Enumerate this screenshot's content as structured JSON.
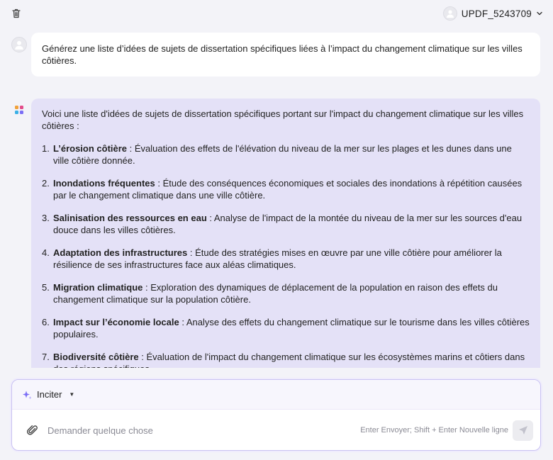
{
  "header": {
    "username": "UPDF_5243709"
  },
  "conversation": {
    "user_message": "Générez une liste d’idées de sujets de dissertation spécifiques liées à l’impact du changement climatique sur les villes côtières.",
    "ai_intro": "Voici une liste d'idées de sujets de dissertation spécifiques portant sur l'impact du changement climatique sur les villes côtières :",
    "ai_items": [
      {
        "num": "1.",
        "title": "L’érosion côtière",
        "text": " : Évaluation des effets de l'élévation du niveau de la mer sur les plages et les dunes dans une ville côtière donnée."
      },
      {
        "num": "2.",
        "title": "Inondations fréquentes",
        "text": " : Étude des conséquences économiques et sociales des inondations à répétition causées par le changement climatique dans une ville côtière."
      },
      {
        "num": "3.",
        "title": "Salinisation des ressources en eau",
        "text": " : Analyse de l'impact de la montée du niveau de la mer sur les sources d'eau douce dans les villes côtières."
      },
      {
        "num": "4.",
        "title": "Adaptation des infrastructures",
        "text": " : Étude des stratégies mises en œuvre par une ville côtière pour améliorer la résilience de ses infrastructures face aux aléas climatiques."
      },
      {
        "num": "5.",
        "title": "Migration climatique",
        "text": " : Exploration des dynamiques de déplacement de la population en raison des effets du changement climatique sur la population côtière."
      },
      {
        "num": "6.",
        "title": "Impact sur l’économie locale",
        "text": " : Analyse des effets du changement climatique sur le tourisme dans les villes côtières populaires."
      },
      {
        "num": "7.",
        "title": "Biodiversité côtière",
        "text": " : Évaluation de l'impact du changement climatique sur les écosystèmes marins et côtiers dans des régions spécifiques."
      }
    ]
  },
  "composer": {
    "prompt_label": "Inciter",
    "input_placeholder": "Demander quelque chose",
    "hint": "Enter Envoyer; Shift + Enter Nouvelle ligne"
  },
  "colors": {
    "accent": "#7b6ef6",
    "ai_bubble": "#e4e1f7",
    "background": "#f3f3f8"
  },
  "icons": [
    "trash-icon",
    "avatar-icon",
    "chevron-down-icon",
    "ai-logo-icon",
    "sparkle-icon",
    "paperclip-icon",
    "send-icon"
  ]
}
